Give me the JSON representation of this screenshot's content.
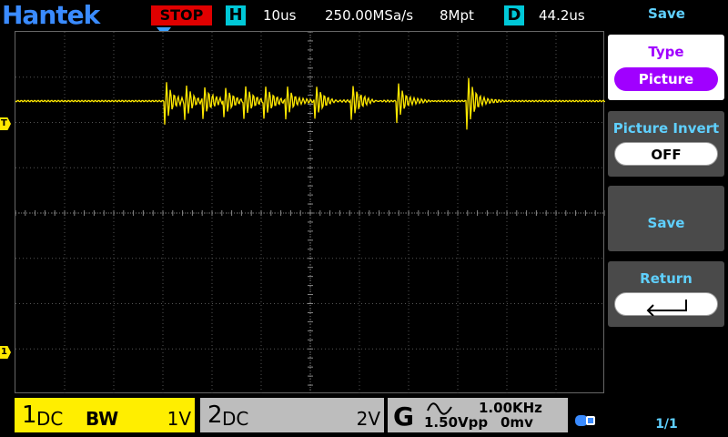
{
  "topbar": {
    "logo": "Hantek",
    "run_state": "STOP",
    "horizontal_key": "H",
    "time_base": "10us",
    "sample_rate": "250.00MSa/s",
    "memory_depth": "8Mpt",
    "delay_key": "D",
    "delay": "44.2us"
  },
  "markers": {
    "trigger_level": "T",
    "channel1": "1"
  },
  "channels": {
    "ch1": {
      "number": "1",
      "coupling": "DC",
      "bandwidth": "BW",
      "scale": "1V",
      "color": "#ffee00"
    },
    "ch2": {
      "number": "2",
      "coupling": "DC",
      "scale": "2V",
      "color": "#bdbdbd"
    }
  },
  "generator": {
    "letter": "G",
    "frequency": "1.00KHz",
    "amplitude": "1.50Vpp",
    "offset": "0mv",
    "waveform_icon": "sine-wave-icon"
  },
  "status_icons": {
    "lan": "lan-icon"
  },
  "menu": {
    "title": "Save",
    "type_label": "Type",
    "type_value": "Picture",
    "invert_label": "Picture Invert",
    "invert_value": "OFF",
    "save_label": "Save",
    "return_label": "Return",
    "return_icon": "return-arrow-icon",
    "page": "1/1"
  },
  "colors": {
    "trace": "#ffe800",
    "accent_cyan": "#5fd0ff",
    "stop_red": "#e00000",
    "type_purple": "#a000ff"
  }
}
